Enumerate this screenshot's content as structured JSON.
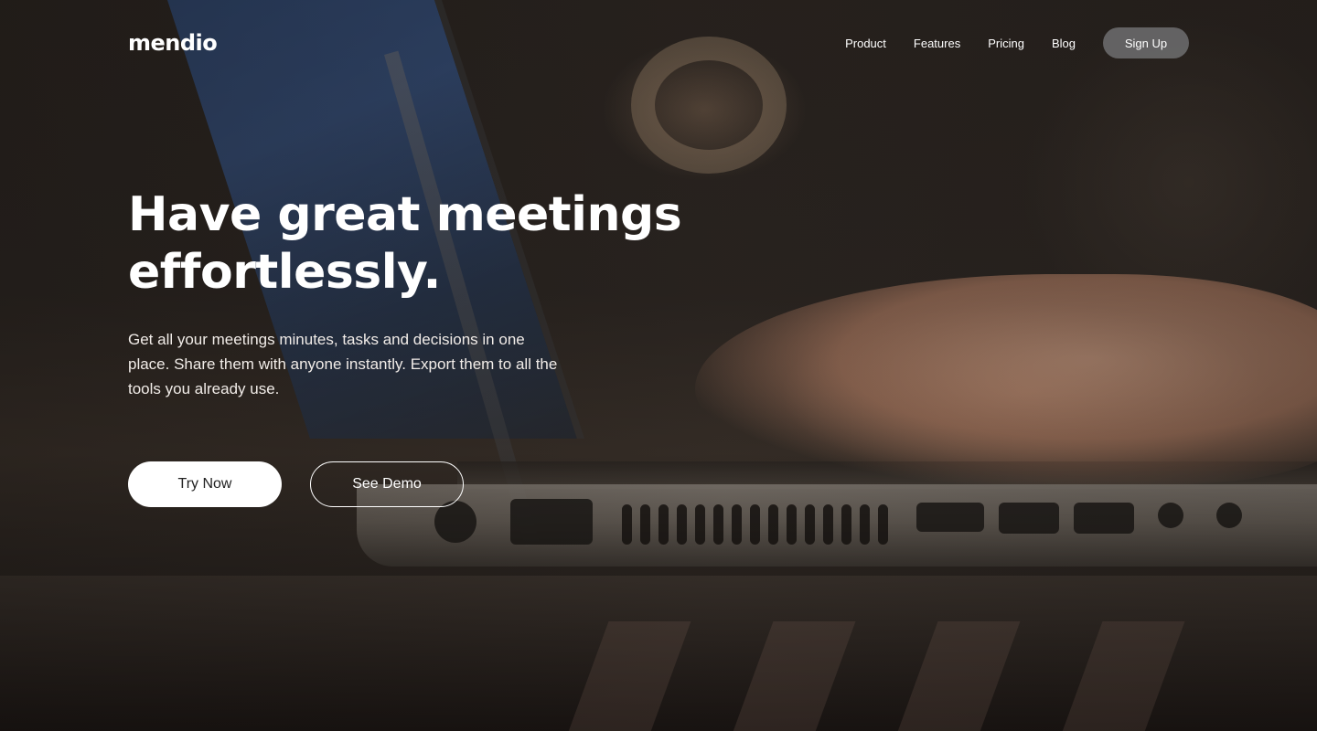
{
  "brand": {
    "logo": "mendio"
  },
  "nav": {
    "links": [
      "Product",
      "Features",
      "Pricing",
      "Blog"
    ],
    "signup_label": "Sign Up"
  },
  "hero": {
    "headline_line1": "Have great meetings",
    "headline_line2": "effortlessly.",
    "subtext": "Get all your meetings minutes, tasks and decisions in one place. Share them with anyone instantly. Export them to all the tools you already use.",
    "primary_cta": "Try Now",
    "secondary_cta": "See Demo"
  },
  "colors": {
    "primary_button_bg": "#ffffff",
    "signup_button_bg": "#6e6e70",
    "text": "#ffffff"
  }
}
